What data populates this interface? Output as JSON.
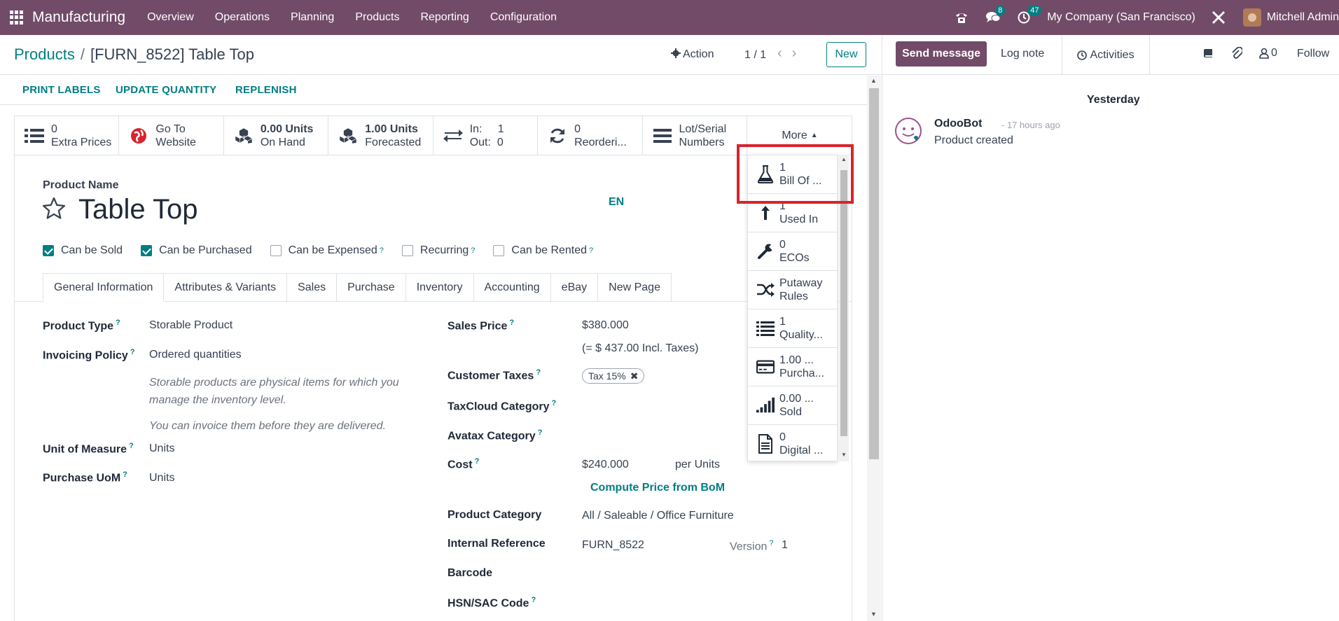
{
  "app": {
    "name": "Manufacturing"
  },
  "nav": {
    "menus": [
      "Overview",
      "Operations",
      "Planning",
      "Products",
      "Reporting",
      "Configuration"
    ]
  },
  "systray": {
    "chat_count": "8",
    "activity_count": "47",
    "company": "My Company (San Francisco)",
    "user": "Mitchell Admin"
  },
  "breadcrumb": {
    "parent": "Products",
    "current": "[FURN_8522] Table Top"
  },
  "control": {
    "action": "Action",
    "pager": "1 / 1",
    "new": "New"
  },
  "status_buttons": [
    "PRINT LABELS",
    "UPDATE QUANTITY",
    "REPLENISH"
  ],
  "smart_buttons": [
    {
      "value": "0",
      "label": "Extra Prices",
      "icon": "list-icon"
    },
    {
      "value": "Go To",
      "label": "Website",
      "icon": "globe-icon"
    },
    {
      "value": "0.00 Units",
      "label": "On Hand",
      "icon": "cubes-icon"
    },
    {
      "value": "1.00 Units",
      "label": "Forecasted",
      "icon": "cubes-icon"
    },
    {
      "value": "In:     1",
      "label": "Out:  0",
      "icon": "exchange-icon"
    },
    {
      "value": "0",
      "label": "Reorderi...",
      "icon": "refresh-icon"
    },
    {
      "value": "Lot/Serial",
      "label": "Numbers",
      "icon": "bars-icon"
    }
  ],
  "more": {
    "label": "More"
  },
  "dropdown": [
    {
      "value": "1",
      "label": "Bill Of ...",
      "icon": "flask-icon"
    },
    {
      "value": "1",
      "label": "Used In",
      "icon": "level-up-icon"
    },
    {
      "value": "0",
      "label": "ECOs",
      "icon": "wrench-icon"
    },
    {
      "value": "Putaway",
      "label": "Rules",
      "icon": "random-icon"
    },
    {
      "value": "1",
      "label": "Quality...",
      "icon": "list-icon"
    },
    {
      "value": "1.00 ...",
      "label": "Purcha...",
      "icon": "credit-card-icon"
    },
    {
      "value": "0.00 ...",
      "label": "Sold",
      "icon": "signal-icon"
    },
    {
      "value": "0",
      "label": "Digital ...",
      "icon": "document-icon"
    }
  ],
  "product": {
    "name_label": "Product Name",
    "name": "Table Top",
    "lang": "EN",
    "checks": [
      {
        "label": "Can be Sold",
        "checked": true,
        "help": false
      },
      {
        "label": "Can be Purchased",
        "checked": true,
        "help": false
      },
      {
        "label": "Can be Expensed",
        "checked": false,
        "help": true
      },
      {
        "label": "Recurring",
        "checked": false,
        "help": true
      },
      {
        "label": "Can be Rented",
        "checked": false,
        "help": true
      }
    ]
  },
  "tabs": [
    "General Information",
    "Attributes & Variants",
    "Sales",
    "Purchase",
    "Inventory",
    "Accounting",
    "eBay",
    "New Page"
  ],
  "left_fields": {
    "product_type_label": "Product Type",
    "product_type": "Storable Product",
    "invoicing_label": "Invoicing Policy",
    "invoicing": "Ordered quantities",
    "help1": "Storable products are physical items for which you manage the inventory level.",
    "help2": "You can invoice them before they are delivered.",
    "uom_label": "Unit of Measure",
    "uom": "Units",
    "puom_label": "Purchase UoM",
    "puom": "Units"
  },
  "right_fields": {
    "sales_price_label": "Sales Price",
    "sales_price": "$380.000",
    "incl_taxes": "(= $ 437.00 Incl. Taxes)",
    "customer_taxes_label": "Customer Taxes",
    "tax_tag": "Tax 15%",
    "taxcloud_label": "TaxCloud Category",
    "avatax_label": "Avatax Category",
    "cost_label": "Cost",
    "cost": "$240.000",
    "cost_unit": "per Units",
    "compute": "Compute Price from BoM",
    "category_label": "Product Category",
    "category": "All / Saleable / Office Furniture",
    "ref_label": "Internal Reference",
    "ref": "FURN_8522",
    "version_label": "Version",
    "version": "1",
    "barcode_label": "Barcode",
    "hsn_label": "HSN/SAC Code"
  },
  "chatter": {
    "send": "Send message",
    "log": "Log note",
    "activities": "Activities",
    "followers": "0",
    "follow": "Follow",
    "day": "Yesterday",
    "author": "OdooBot",
    "time": "- 17 hours ago",
    "body": "Product created"
  },
  "colors": {
    "brand": "#714B67",
    "accent": "#017e84",
    "highlight": "#d9232d"
  }
}
